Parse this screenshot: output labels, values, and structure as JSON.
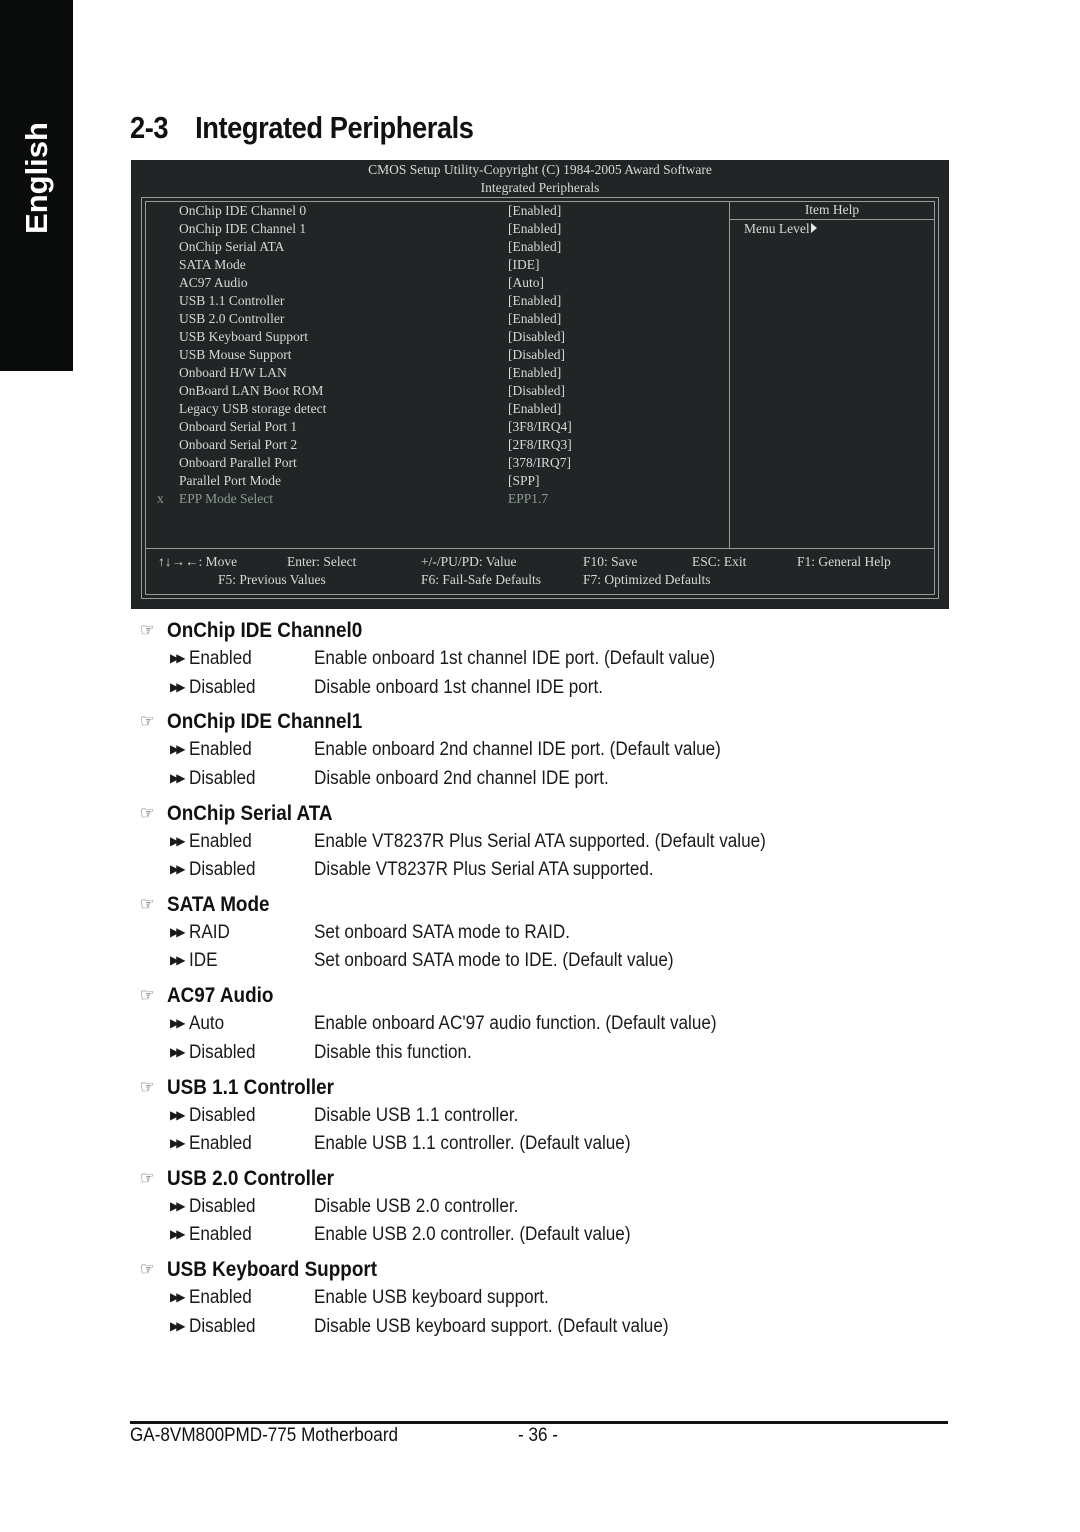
{
  "side_tab": {
    "label": "English"
  },
  "section": {
    "number": "2-3",
    "title": "Integrated Peripherals"
  },
  "bios": {
    "header_line1": "CMOS Setup Utility-Copyright (C) 1984-2005 Award Software",
    "header_line2": "Integrated Peripherals",
    "item_help_title": "Item Help",
    "menu_level": "Menu Level",
    "items": [
      {
        "label": "OnChip IDE Channel 0",
        "value": "[Enabled]",
        "mark": ""
      },
      {
        "label": "OnChip IDE Channel 1",
        "value": "[Enabled]",
        "mark": ""
      },
      {
        "label": "OnChip Serial ATA",
        "value": "[Enabled]",
        "mark": ""
      },
      {
        "label": "SATA Mode",
        "value": "[IDE]",
        "mark": ""
      },
      {
        "label": "AC97 Audio",
        "value": "[Auto]",
        "mark": ""
      },
      {
        "label": "USB 1.1 Controller",
        "value": "[Enabled]",
        "mark": ""
      },
      {
        "label": "USB 2.0 Controller",
        "value": "[Enabled]",
        "mark": ""
      },
      {
        "label": "USB Keyboard Support",
        "value": "[Disabled]",
        "mark": ""
      },
      {
        "label": "USB Mouse Support",
        "value": "[Disabled]",
        "mark": ""
      },
      {
        "label": "Onboard H/W LAN",
        "value": "[Enabled]",
        "mark": ""
      },
      {
        "label": "OnBoard LAN Boot ROM",
        "value": "[Disabled]",
        "mark": ""
      },
      {
        "label": "Legacy USB storage detect",
        "value": "[Enabled]",
        "mark": ""
      },
      {
        "label": "Onboard Serial Port 1",
        "value": "[3F8/IRQ4]",
        "mark": ""
      },
      {
        "label": "Onboard Serial Port 2",
        "value": "[2F8/IRQ3]",
        "mark": ""
      },
      {
        "label": "Onboard Parallel Port",
        "value": "[378/IRQ7]",
        "mark": ""
      },
      {
        "label": "Parallel Port Mode",
        "value": "[SPP]",
        "mark": ""
      },
      {
        "label": "EPP Mode Select",
        "value": "EPP1.7",
        "mark": "x",
        "disabled": true
      }
    ],
    "keys": {
      "move": "↑↓→←: Move",
      "enter": "Enter: Select",
      "value": "+/-/PU/PD: Value",
      "save": "F10: Save",
      "exit": "ESC: Exit",
      "help": "F1: General Help",
      "prev": "F5: Previous Values",
      "failsafe": "F6: Fail-Safe Defaults",
      "optimized": "F7: Optimized Defaults"
    }
  },
  "options": [
    {
      "title": "OnChip IDE Channel0",
      "choices": [
        {
          "name": "Enabled",
          "desc": "Enable onboard 1st channel IDE port. (Default value)"
        },
        {
          "name": "Disabled",
          "desc": "Disable onboard 1st channel IDE port."
        }
      ]
    },
    {
      "title": "OnChip IDE Channel1",
      "choices": [
        {
          "name": "Enabled",
          "desc": "Enable onboard 2nd channel IDE port. (Default value)"
        },
        {
          "name": "Disabled",
          "desc": "Disable onboard 2nd channel IDE port."
        }
      ]
    },
    {
      "title": "OnChip Serial ATA",
      "choices": [
        {
          "name": "Enabled",
          "desc": "Enable VT8237R Plus Serial ATA supported. (Default value)"
        },
        {
          "name": "Disabled",
          "desc": "Disable VT8237R Plus Serial ATA supported."
        }
      ]
    },
    {
      "title": "SATA Mode",
      "choices": [
        {
          "name": "RAID",
          "desc": "Set onboard SATA mode to RAID."
        },
        {
          "name": "IDE",
          "desc": "Set onboard SATA mode to IDE. (Default value)"
        }
      ]
    },
    {
      "title": "AC97 Audio",
      "choices": [
        {
          "name": "Auto",
          "desc": "Enable onboard AC'97 audio function. (Default value)"
        },
        {
          "name": "Disabled",
          "desc": "Disable this function."
        }
      ]
    },
    {
      "title": "USB 1.1 Controller",
      "choices": [
        {
          "name": "Disabled",
          "desc": "Disable USB 1.1 controller."
        },
        {
          "name": "Enabled",
          "desc": "Enable USB 1.1 controller. (Default value)"
        }
      ]
    },
    {
      "title": "USB 2.0 Controller",
      "choices": [
        {
          "name": "Disabled",
          "desc": "Disable USB 2.0 controller."
        },
        {
          "name": "Enabled",
          "desc": "Enable USB 2.0 controller. (Default value)"
        }
      ]
    },
    {
      "title": "USB Keyboard Support",
      "choices": [
        {
          "name": "Enabled",
          "desc": "Enable USB keyboard support."
        },
        {
          "name": "Disabled",
          "desc": "Disable USB keyboard support. (Default value)"
        }
      ]
    }
  ],
  "icons": {
    "section_bullet": "☞",
    "choice_bullet": "▶▶"
  },
  "footer": {
    "model": "GA-8VM800PMD-775 Motherboard",
    "page": "- 36 -"
  }
}
